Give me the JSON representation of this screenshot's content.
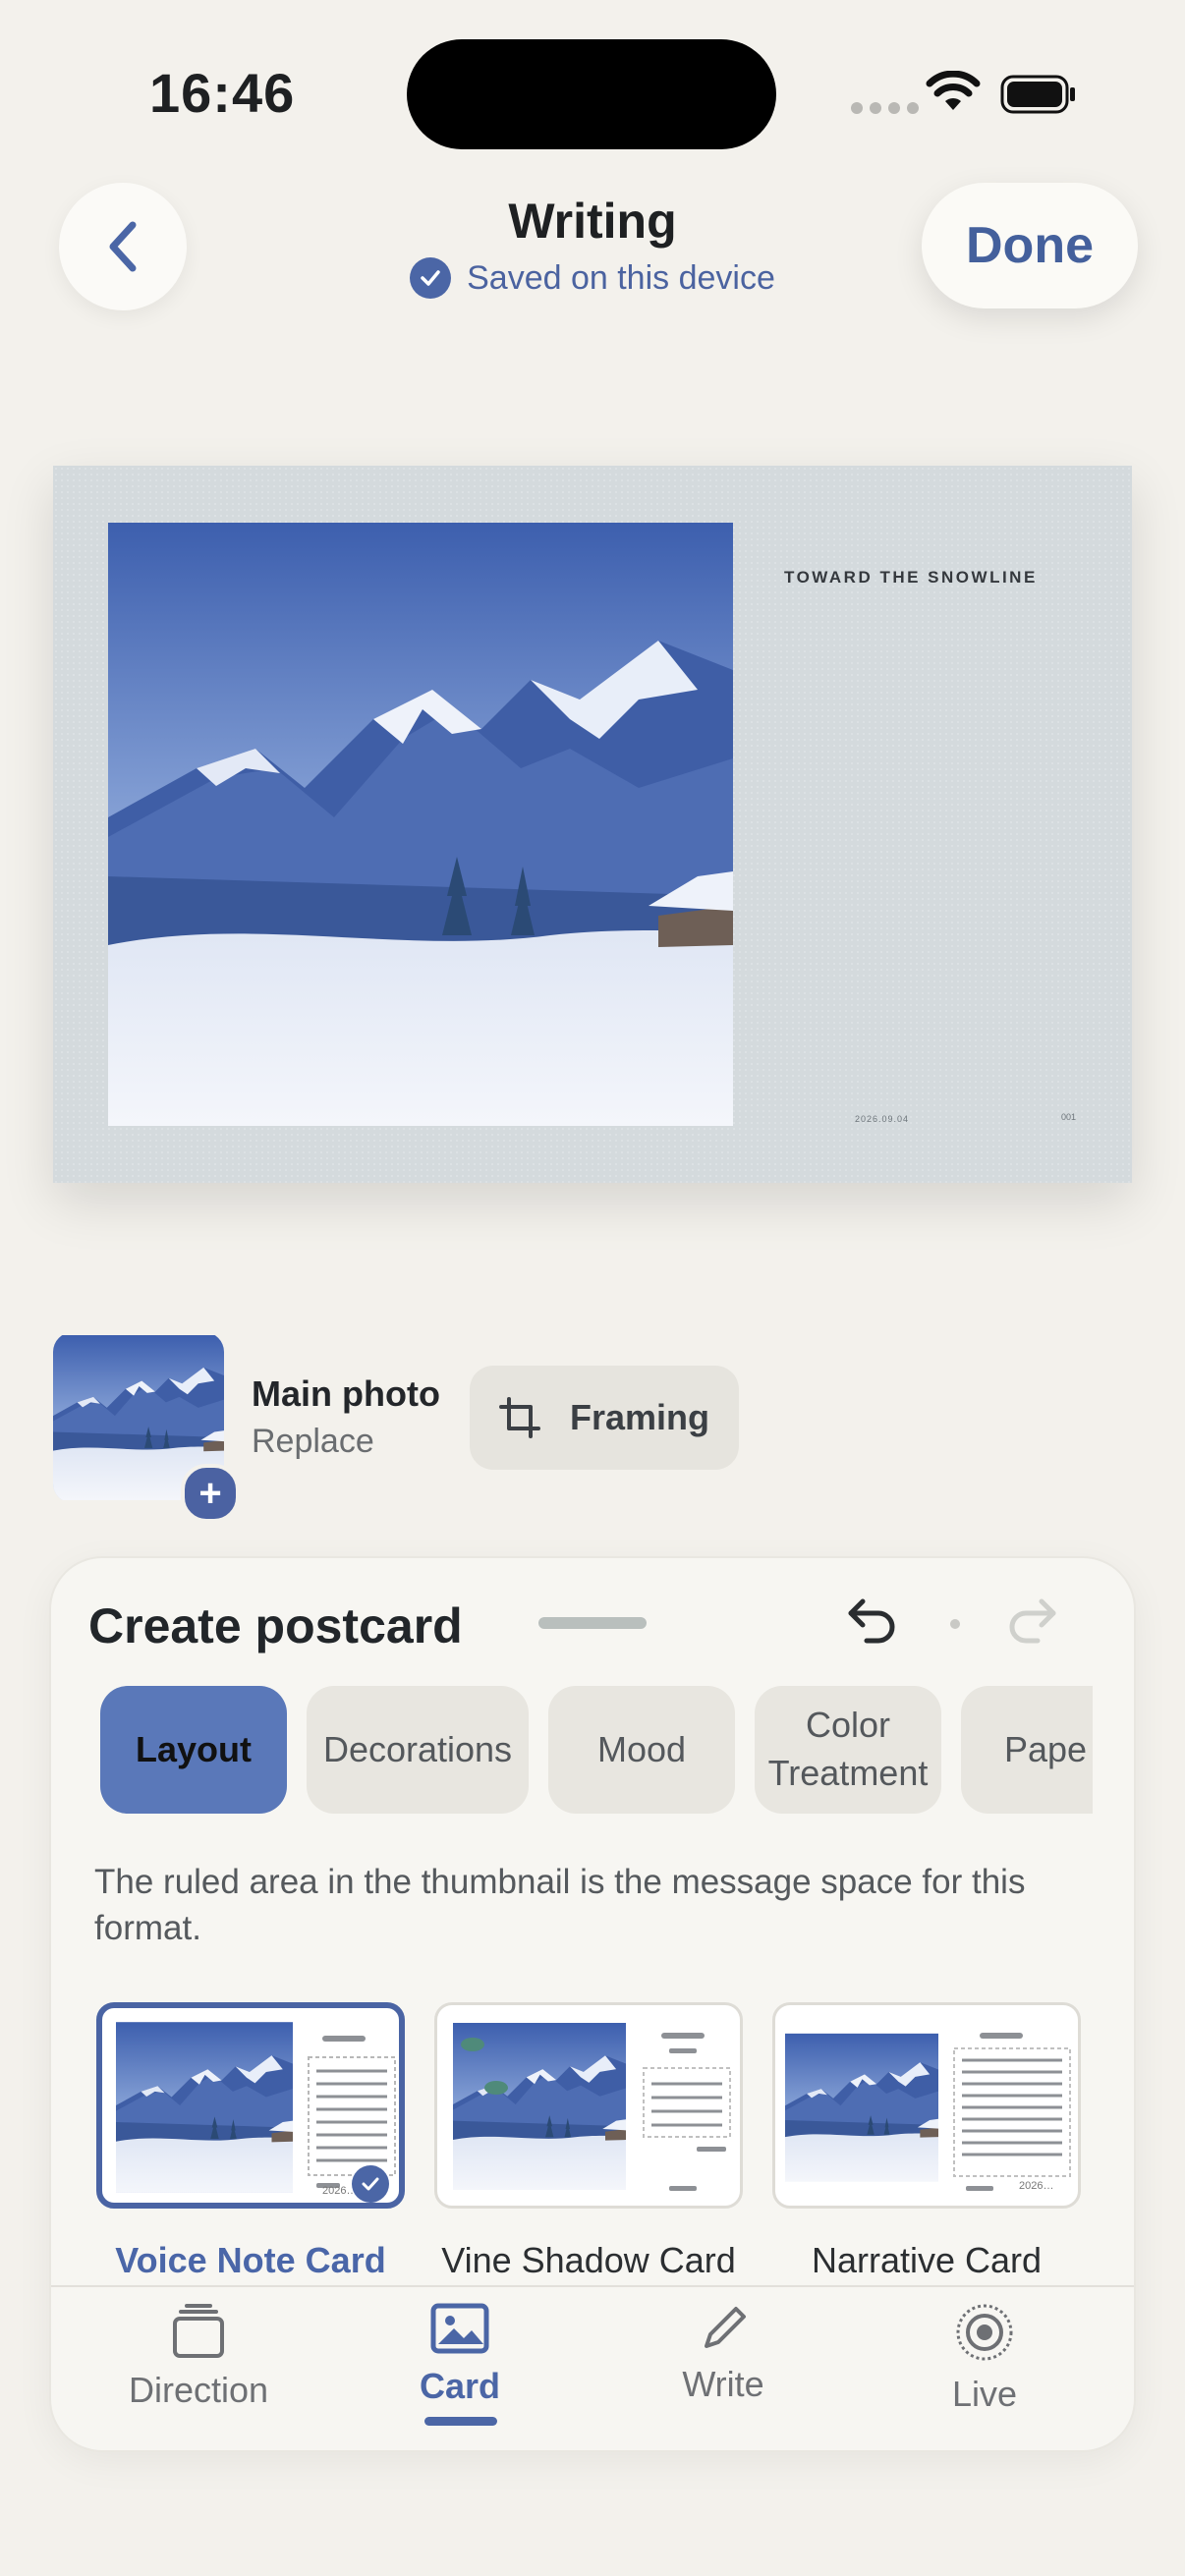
{
  "status_bar": {
    "time": "16:46"
  },
  "header": {
    "title": "Writing",
    "saved_text": "Saved on this device",
    "done_label": "Done"
  },
  "postcard": {
    "heading": "TOWARD THE SNOWLINE",
    "date": "2026.09.04",
    "number": "001"
  },
  "main_photo": {
    "label": "Main photo",
    "sublabel": "Replace",
    "framing_label": "Framing"
  },
  "panel": {
    "title": "Create postcard",
    "tabs": [
      {
        "label": "Layout",
        "active": true
      },
      {
        "label": "Decorations",
        "active": false
      },
      {
        "label": "Mood",
        "active": false
      },
      {
        "label": "Color Treatment",
        "active": false
      },
      {
        "label": "Pape",
        "active": false
      }
    ],
    "description": "The ruled area in the thumbnail is the message space for this format.",
    "layouts": [
      {
        "label": "Voice Note Card",
        "selected": true,
        "thumb_date": "2026…"
      },
      {
        "label": "Vine Shadow Card",
        "selected": false
      },
      {
        "label": "Narrative Card",
        "selected": false,
        "thumb_date": "2026…"
      }
    ]
  },
  "bottom_nav": [
    {
      "label": "Direction",
      "icon": "stack-icon",
      "active": false
    },
    {
      "label": "Card",
      "icon": "photo-icon",
      "active": true
    },
    {
      "label": "Write",
      "icon": "pencil-icon",
      "active": false
    },
    {
      "label": "Live",
      "icon": "broadcast-icon",
      "active": false
    }
  ],
  "colors": {
    "background": "#f3f1ec",
    "accent": "#4b66a6",
    "active_tab": "#5a78b9",
    "postcard_paper": "#d4dadd"
  }
}
